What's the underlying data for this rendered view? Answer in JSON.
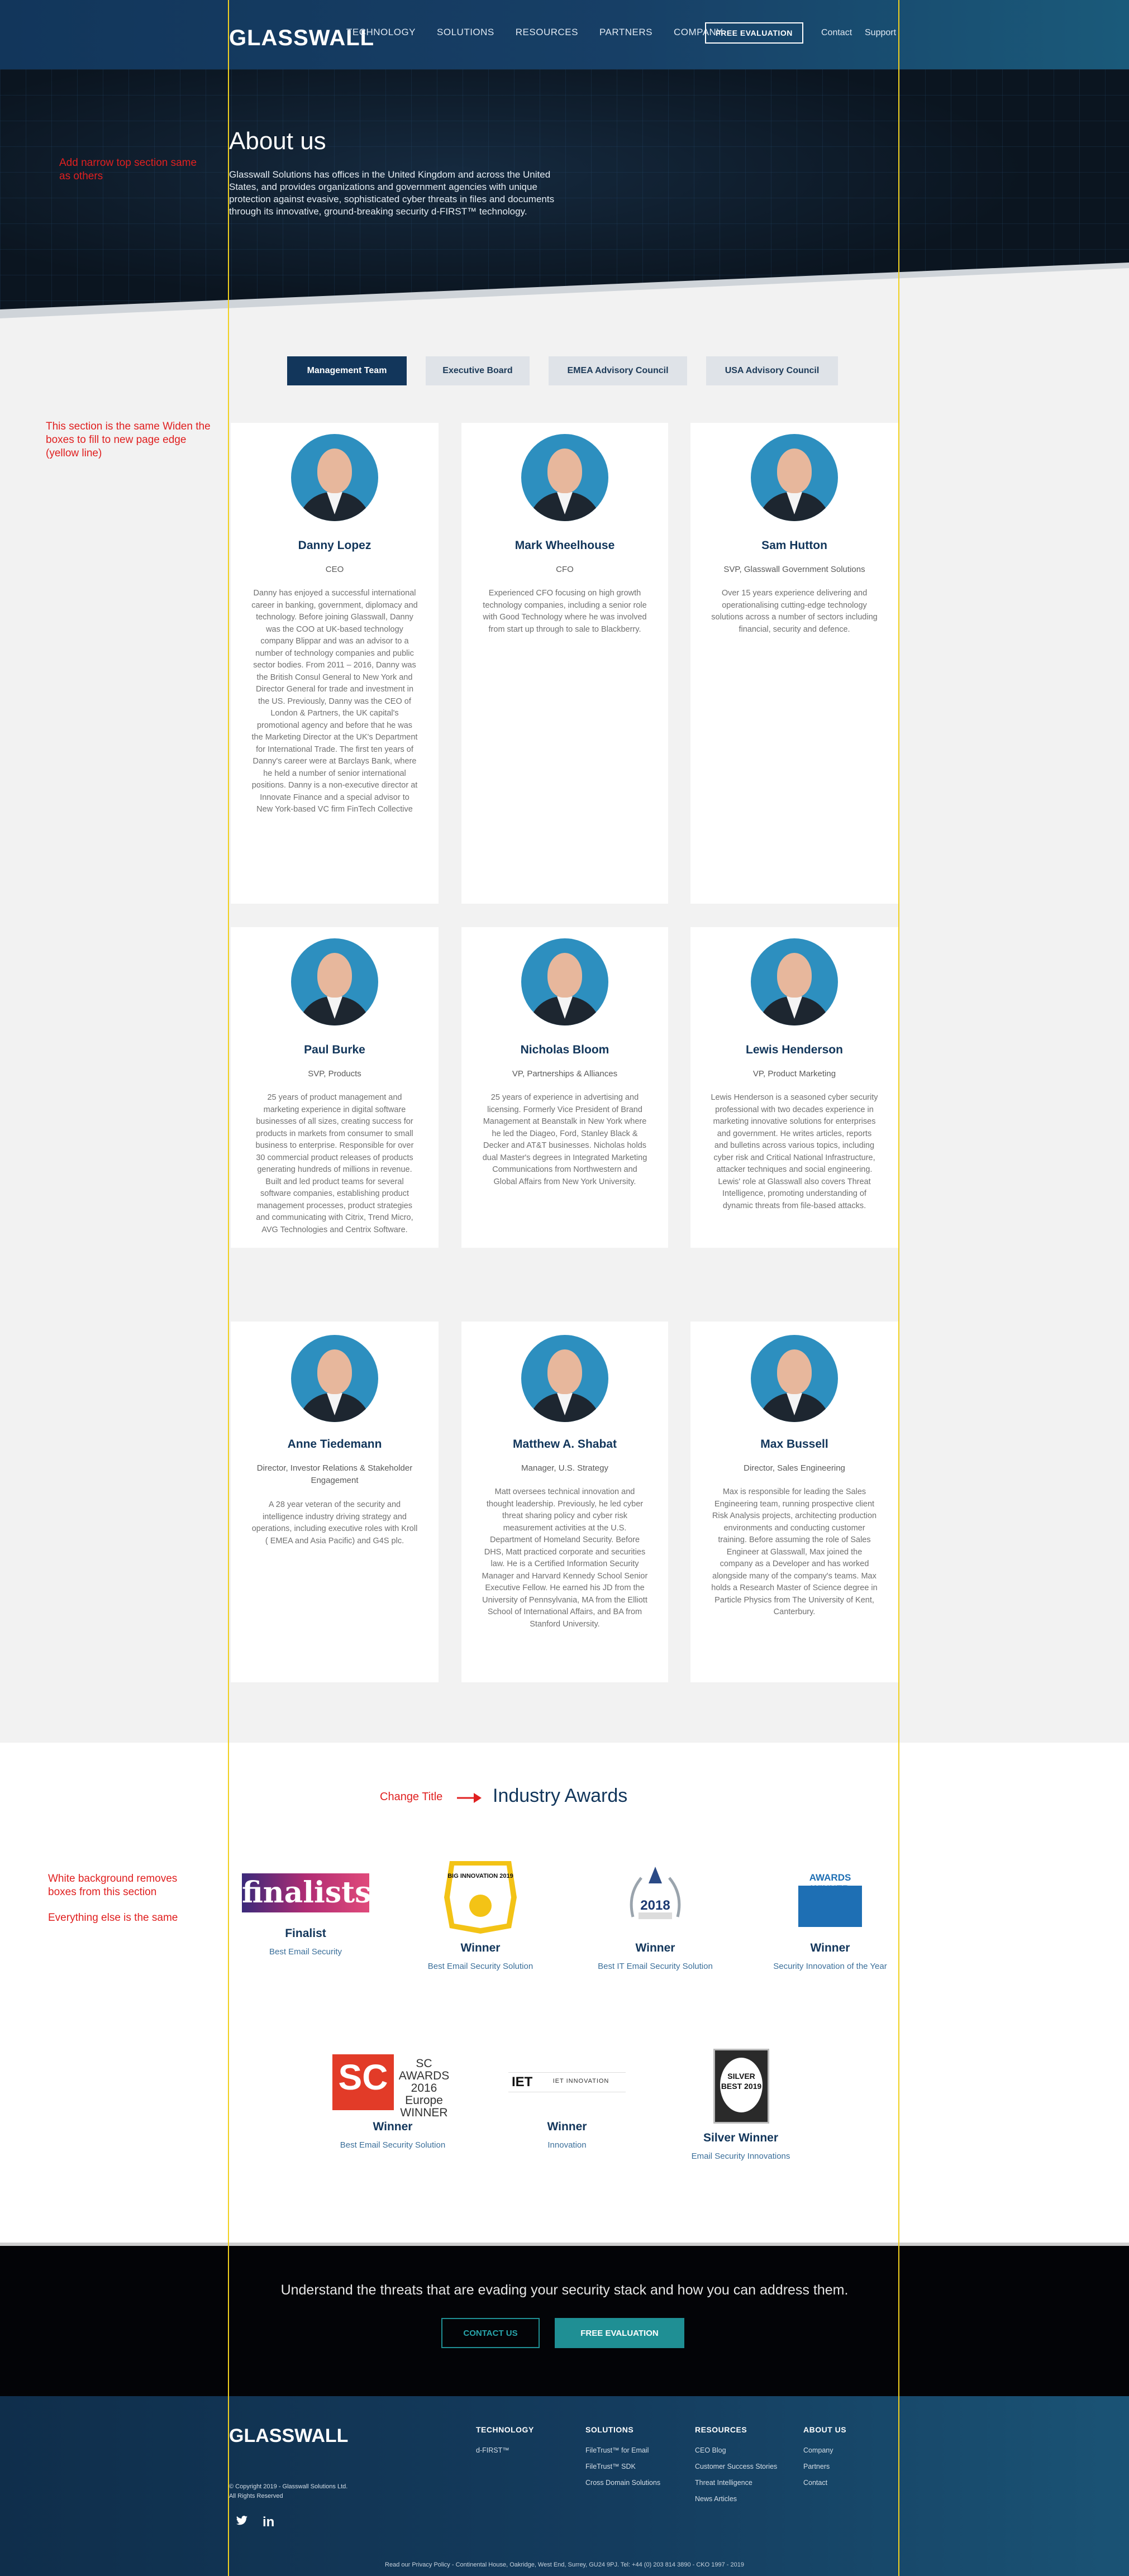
{
  "header": {
    "logo": "GLASSWALL",
    "nav": [
      "TECHNOLOGY",
      "SOLUTIONS",
      "RESOURCES",
      "PARTNERS",
      "COMPANY"
    ],
    "cta": "FREE EVALUATION",
    "contact": "Contact",
    "support": "Support"
  },
  "hero": {
    "title": "About us",
    "text": "Glasswall Solutions has offices in the United Kingdom and across the United States, and provides organizations and government agencies with unique protection against evasive, sophisticated cyber threats in files and documents through its innovative, ground-breaking security d-FIRST™ technology."
  },
  "notes": {
    "top": "Add narrow top section same as others",
    "section": "This section is the same Widen the boxes to fill to new page edge (yellow line)",
    "change_title": "Change Title",
    "white_bg": "White background removes boxes from this section",
    "everything": "Everything else is the same"
  },
  "tabs": [
    "Management Team",
    "Executive Board",
    "EMEA Advisory Council",
    "USA Advisory Council"
  ],
  "team": [
    {
      "name": "Danny Lopez",
      "role": "CEO",
      "bio": "Danny has enjoyed a successful international career in banking, government, diplomacy and technology. Before joining Glasswall, Danny was the COO at UK-based technology company Blippar and was an advisor to a number of technology companies and public sector bodies. From 2011 – 2016, Danny was the British Consul General to New York and Director General for trade and investment in the US. Previously, Danny was the CEO of London & Partners, the UK capital's promotional agency and before that he was the Marketing Director at the UK's Department for International Trade. The first ten years of Danny's career were at Barclays Bank, where he held a number of senior international positions. Danny is a non-executive director at Innovate Finance and a special advisor to New York-based VC firm FinTech Collective"
    },
    {
      "name": "Mark Wheelhouse",
      "role": "CFO",
      "bio": "Experienced CFO focusing on high growth technology companies, including a senior role with Good Technology where he was involved from start up through to sale to Blackberry."
    },
    {
      "name": "Sam Hutton",
      "role": "SVP, Glasswall Government Solutions",
      "bio": "Over 15 years experience delivering and operationalising cutting-edge technology solutions across a number of sectors including financial, security and defence."
    },
    {
      "name": "Paul Burke",
      "role": "SVP, Products",
      "bio": "25 years of product management and marketing experience in digital software businesses of all sizes, creating success for products in markets from consumer to small business to enterprise. Responsible for over 30 commercial product releases of products generating hundreds of millions in revenue. Built and led product teams for several software companies, establishing product management processes, product strategies and communicating with Citrix, Trend Micro, AVG Technologies and Centrix Software."
    },
    {
      "name": "Nicholas Bloom",
      "role": "VP, Partnerships & Alliances",
      "bio": "25 years of experience in advertising and licensing. Formerly Vice President of Brand Management at Beanstalk in New York where he led the Diageo, Ford, Stanley Black & Decker and AT&T businesses. Nicholas holds dual Master's degrees in Integrated Marketing Communications from Northwestern and Global Affairs from New York University."
    },
    {
      "name": "Lewis Henderson",
      "role": "VP, Product Marketing",
      "bio": "Lewis Henderson is a seasoned cyber security professional with two decades experience in marketing innovative solutions for enterprises and government. He writes articles, reports and bulletins across various topics, including cyber risk and Critical National Infrastructure, attacker techniques and social engineering. Lewis' role at Glasswall also covers Threat Intelligence, promoting understanding of dynamic threats from file-based attacks."
    },
    {
      "name": "Anne Tiedemann",
      "role": "Director, Investor Relations & Stakeholder Engagement",
      "bio": "A 28 year veteran of the security and intelligence industry driving strategy and operations, including executive roles with Kroll ( EMEA and Asia Pacific) and G4S plc."
    },
    {
      "name": "Matthew A. Shabat",
      "role": "Manager, U.S. Strategy",
      "bio": "Matt oversees technical innovation and thought leadership. Previously, he led cyber threat sharing policy and cyber risk measurement activities at the U.S. Department of Homeland Security.  Before DHS, Matt practiced corporate and securities law. He is a Certified Information Security Manager and Harvard Kennedy School Senior Executive Fellow.  He earned his JD from the University of Pennsylvania, MA from the Elliott School of International Affairs, and BA from Stanford University."
    },
    {
      "name": "Max Bussell",
      "role": "Director, Sales Engineering",
      "bio": "Max is responsible for leading the Sales Engineering team, running prospective client Risk Analysis projects, architecting production environments and conducting customer training. Before assuming the role of Sales Engineer at Glasswall, Max joined the company as a Developer and has worked alongside many of the company's teams. Max holds a Research Master of Science degree in Particle Physics from The University of Kent, Canterbury."
    }
  ],
  "awards": {
    "title": "Industry Awards",
    "items": [
      {
        "logo_text": "finalists",
        "status": "Finalist",
        "desc": "Best Email Security"
      },
      {
        "logo_text": "BIG INNOVATION 2019",
        "status": "Winner",
        "desc": "Best Email Security Solution"
      },
      {
        "logo_text": "2018",
        "status": "Winner",
        "desc": "Best IT Email Security Solution"
      },
      {
        "logo_text": "AWARDS WINNER",
        "status": "Winner",
        "desc": "Security Innovation of the Year"
      },
      {
        "logo_text": "SC AWARDS 2016 Europe WINNER",
        "status": "Winner",
        "desc": "Best Email Security Solution"
      },
      {
        "logo_text": "IET INNOVATION",
        "status": "Winner",
        "desc": "Innovation"
      },
      {
        "logo_text": "SILVER BEST 2019",
        "status": "Silver Winner",
        "desc": "Email Security Innovations"
      }
    ]
  },
  "cta": {
    "text": "Understand the threats that are evading your security stack and how you can address them.",
    "contact": "CONTACT US",
    "free": "FREE EVALUATION"
  },
  "footer": {
    "logo": "GLASSWALL",
    "copyright1": "© Copyright 2019 - Glasswall Solutions Ltd.",
    "copyright2": "All Rights Reserved",
    "columns": [
      {
        "heading": "TECHNOLOGY",
        "links": [
          "d-FIRST™"
        ]
      },
      {
        "heading": "SOLUTIONS",
        "links": [
          "FileTrust™ for Email",
          "FileTrust™ SDK",
          "Cross Domain Solutions"
        ]
      },
      {
        "heading": "RESOURCES",
        "links": [
          "CEO Blog",
          "Customer Success Stories",
          "Threat Intelligence",
          "News Articles"
        ]
      },
      {
        "heading": "ABOUT US",
        "links": [
          "Company",
          "Partners",
          "Contact"
        ]
      }
    ],
    "bottom": "Read our Privacy Policy - Continental House, Oakridge, West End, Surrey, GU24 9PJ. Tel: +44 (0) 203 814 3890 - CKO 1997 - 2019"
  }
}
